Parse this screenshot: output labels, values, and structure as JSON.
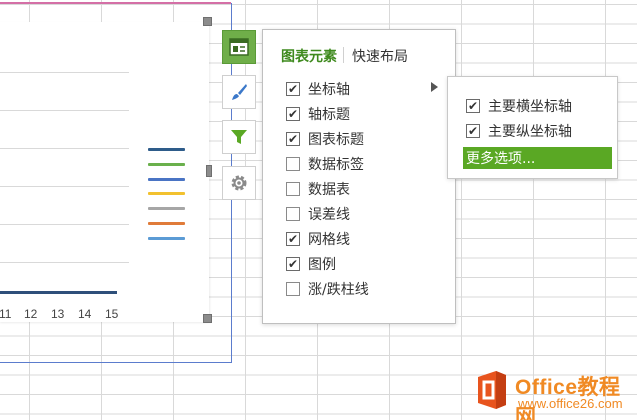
{
  "chart": {
    "x_ticks": [
      "11",
      "12",
      "13",
      "14",
      "15"
    ],
    "legend_colors": [
      "#2e5c8a",
      "#6ab04c",
      "#4a74c4",
      "#f2c12e",
      "#a6a6a6",
      "#e07b39",
      "#5b9bd5"
    ]
  },
  "side_buttons": [
    {
      "name": "chart-elements-icon",
      "active": true
    },
    {
      "name": "chart-style-brush-icon",
      "active": false
    },
    {
      "name": "chart-filter-icon",
      "active": false
    },
    {
      "name": "chart-settings-gear-icon",
      "active": false
    }
  ],
  "popup": {
    "tabs": [
      "图表元素",
      "快速布局"
    ],
    "items": [
      {
        "label": "坐标轴",
        "checked": true
      },
      {
        "label": "轴标题",
        "checked": true
      },
      {
        "label": "图表标题",
        "checked": true
      },
      {
        "label": "数据标签",
        "checked": false
      },
      {
        "label": "数据表",
        "checked": false
      },
      {
        "label": "误差线",
        "checked": false
      },
      {
        "label": "网格线",
        "checked": true
      },
      {
        "label": "图例",
        "checked": true
      },
      {
        "label": "涨/跌柱线",
        "checked": false
      }
    ]
  },
  "submenu": {
    "items": [
      {
        "label": "主要横坐标轴",
        "checked": true
      },
      {
        "label": "主要纵坐标轴",
        "checked": true
      }
    ],
    "more": "更多选项..."
  },
  "watermark": {
    "title": "Office教程网",
    "url": "www.office26.com"
  },
  "colors": {
    "accent_green": "#5aa824",
    "tab_green": "#3f8a1e",
    "selection_blue": "#5b7ccd",
    "watermark_orange": "#f08a24"
  }
}
